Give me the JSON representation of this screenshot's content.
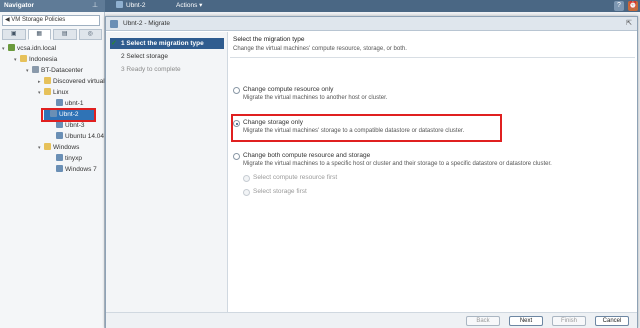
{
  "topbar": {
    "navigator_title": "Navigator",
    "object_tab": "Ubnt-2",
    "actions_label": "Actions",
    "actions_arrow": "▾",
    "help_icon": "?",
    "alarm_icon": "⏰"
  },
  "navigator": {
    "policies_label": "◀ VM Storage Policies",
    "tabs": [
      "▣",
      "▦",
      "▤",
      "◎"
    ],
    "tree": [
      {
        "label": "vcsa.idn.local",
        "icon": "vc",
        "expander": "▾"
      },
      {
        "label": "Indonesia",
        "icon": "folder",
        "expander": "▾"
      },
      {
        "label": "BT-Datacenter",
        "icon": "dc",
        "expander": "▾"
      },
      {
        "label": "Discovered virtual",
        "icon": "folder",
        "expander": "▸"
      },
      {
        "label": "Linux",
        "icon": "folder",
        "expander": "▾"
      },
      {
        "label": "ubnt-1",
        "icon": "vm",
        "expander": ""
      },
      {
        "label": "Ubnt-2",
        "icon": "vm",
        "expander": ""
      },
      {
        "label": "Ubnt-3",
        "icon": "vm",
        "expander": ""
      },
      {
        "label": "Ubuntu 14.04 T",
        "icon": "vm",
        "expander": ""
      },
      {
        "label": "Windows",
        "icon": "folder",
        "expander": "▾"
      },
      {
        "label": "tinyxp",
        "icon": "vm",
        "expander": ""
      },
      {
        "label": "Windows 7",
        "icon": "vm",
        "expander": ""
      }
    ]
  },
  "dialog": {
    "title": "Ubnt-2 - Migrate",
    "minimize_icon": "⇱",
    "steps": [
      {
        "label": "1  Select the migration type",
        "state": "active",
        "check": "✓"
      },
      {
        "label": "2  Select storage",
        "state": "normal"
      },
      {
        "label": "3  Ready to complete",
        "state": "disabled"
      }
    ],
    "main": {
      "title": "Select the migration type",
      "subtitle": "Change the virtual machines' compute resource, storage, or both.",
      "options": [
        {
          "label": "Change compute resource only",
          "desc": "Migrate the virtual machines to another host or cluster.",
          "checked": false
        },
        {
          "label": "Change storage only",
          "desc": "Migrate the virtual machines' storage to a compatible datastore or datastore cluster.",
          "checked": true
        },
        {
          "label": "Change both compute resource and storage",
          "desc": "Migrate the virtual machines to a specific host or cluster and their storage to a specific datastore or datastore cluster.",
          "checked": false
        }
      ],
      "sub_options": [
        {
          "label": "Select compute resource first"
        },
        {
          "label": "Select storage first"
        }
      ]
    },
    "buttons": {
      "back": "Back",
      "next": "Next",
      "finish": "Finish",
      "cancel": "Cancel"
    }
  },
  "colors": {
    "highlight": "#e02020",
    "active_step": "#2f5c8f",
    "selected_tree": "#2f73b6"
  }
}
